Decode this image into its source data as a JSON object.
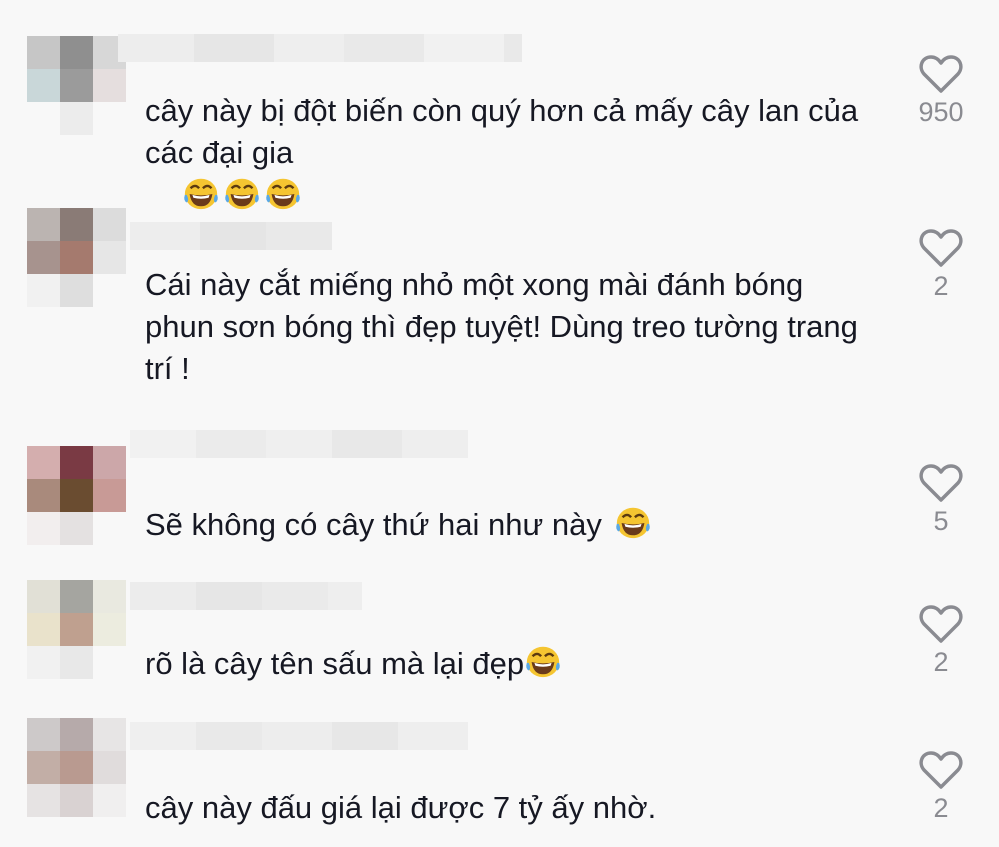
{
  "comments": [
    {
      "text": "cây này bị đột biến còn quý hơn cả mấy cây lan của các đại gia",
      "emojis": [
        "face-with-tears-of-joy-icon",
        "face-with-tears-of-joy-icon",
        "face-with-tears-of-joy-icon"
      ],
      "likes": "950",
      "avatar_colors": [
        "#c6c6c6",
        "#8f8f8f",
        "#d7d7d7",
        "#c9d7d9",
        "#9b9b9b",
        "#e5dede",
        "#f3f3f3",
        "#ececec",
        "#f8f8f8"
      ]
    },
    {
      "text": "Cái này cắt miếng nhỏ một xong mài đánh bóng phun sơn bóng thì đẹp tuyệt! Dùng treo tường trang trí !",
      "emojis": [],
      "likes": "2",
      "avatar_colors": [
        "#bbb4b1",
        "#8a7b76",
        "#dcdcdc",
        "#a7938e",
        "#a57a6e",
        "#e6e6e6",
        "#f1f1f1",
        "#dedede",
        "#f8f8f8"
      ]
    },
    {
      "text": "Sẽ không có cây thứ hai như này",
      "emojis": [
        "face-with-tears-of-joy-icon"
      ],
      "likes": "5",
      "avatar_colors": [
        "#d4aeae",
        "#7a3a44",
        "#cca7a9",
        "#a98a7c",
        "#6a4c30",
        "#c89a96",
        "#f2eeee",
        "#e4e1e1",
        "#f8f8f8"
      ]
    },
    {
      "text": "rõ là cây tên sấu mà lại đẹp",
      "emojis": [
        "face-with-tears-of-joy-icon"
      ],
      "likes": "2",
      "avatar_colors": [
        "#e1e0d6",
        "#a5a5a0",
        "#e9e9e0",
        "#e9e2cb",
        "#bfa08f",
        "#ececdf",
        "#f1f1f1",
        "#e8e8e8",
        "#f8f8f8"
      ]
    },
    {
      "text": "cây này đấu giá lại được 7 tỷ ấy nhờ.",
      "emojis": [],
      "likes": "2",
      "avatar_colors": [
        "#cdc9c9",
        "#b6aaaa",
        "#e7e5e5",
        "#c2aea6",
        "#b99a90",
        "#e0dcdc",
        "#e6e3e3",
        "#d9d2d2",
        "#f0efef"
      ]
    }
  ],
  "colors": {
    "background": "#f8f8f8",
    "text": "#161823",
    "like_count": "#8a8b91",
    "heart_stroke": "#8a8b91"
  }
}
